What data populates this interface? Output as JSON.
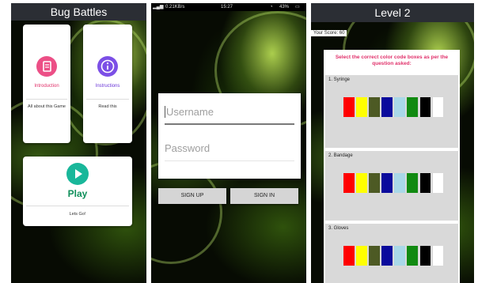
{
  "screen1": {
    "title": "Bug Battles",
    "tiles": [
      {
        "label": "Introduction",
        "sub": "All about this Game",
        "icon": "document-icon",
        "color": "#ec4f86",
        "label_color": "#e0306a"
      },
      {
        "label": "Instructions",
        "sub": "Read this",
        "icon": "info-icon",
        "color": "#7b4fe6",
        "label_color": "#6a35d8"
      }
    ],
    "play": {
      "label": "Play",
      "sub": "Lets Go!",
      "icon": "play-icon",
      "color": "#19b79a",
      "label_color": "#0f8f5a"
    }
  },
  "screen2": {
    "status": {
      "carrier": "0.21KB/s",
      "time": "15:27",
      "battery": "43%"
    },
    "username_placeholder": "Username",
    "password_placeholder": "Password",
    "signup_label": "SIGN UP",
    "signin_label": "SIGN IN"
  },
  "screen3": {
    "title": "Level 2",
    "score_label": "Your Score: 60",
    "question": "Select the correct color code boxes as per the question asked:",
    "items": [
      {
        "label": "1. Syringe"
      },
      {
        "label": "2. Bandage"
      },
      {
        "label": "3. Gloves"
      }
    ],
    "swatch_colors": [
      "#ff0000",
      "#ffff00",
      "#4d5a24",
      "#0a0a9c",
      "#a9d8e8",
      "#118a11",
      "#000000",
      "#ffffff"
    ]
  }
}
